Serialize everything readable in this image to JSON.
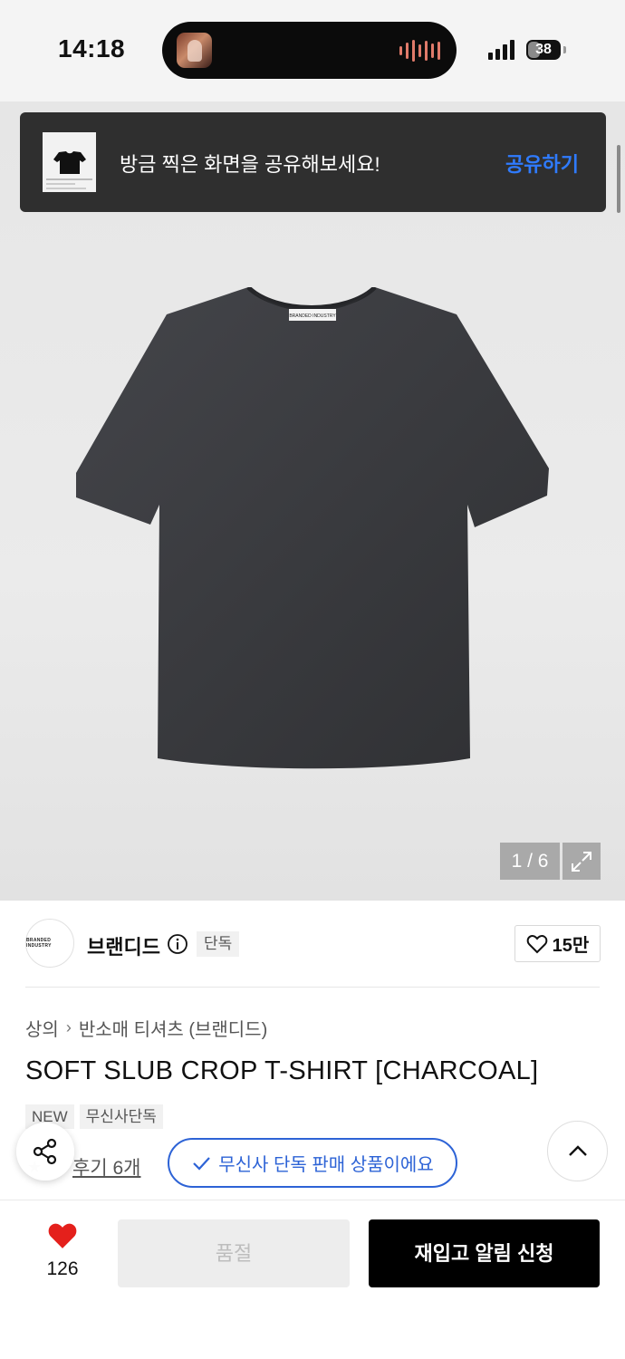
{
  "status_bar": {
    "time": "14:18",
    "battery": "38",
    "battery_level": 0.38
  },
  "toast": {
    "message": "방금 찍은 화면을 공유해보세요!",
    "action": "공유하기"
  },
  "gallery": {
    "counter": "1 / 6",
    "current": 1,
    "total": 6,
    "shirt_label": "BRANDED INDUSTRY"
  },
  "brand": {
    "logo_text": "BRANDED INDUSTRY",
    "name": "브랜디드",
    "exclusive_tag": "단독",
    "likes": "15만"
  },
  "product": {
    "breadcrumb": [
      "상의",
      "반소매 티셔츠 (브랜디드)"
    ],
    "title": "SOFT SLUB CROP T-SHIRT [CHARCOAL]",
    "badges": [
      "NEW",
      "무신사단독"
    ],
    "review_link": "후기 6개",
    "exclusive_notice": "무신사 단독 판매 상품이에요"
  },
  "bottom_bar": {
    "wish_count": "126",
    "soldout_label": "품절",
    "restock_label": "재입고 알림 신청"
  },
  "colors": {
    "accent_blue": "#2d63d6",
    "toast_action": "#2f7bff",
    "heart_red": "#e4201c",
    "toast_bg": "#2f2f2f",
    "shirt_charcoal": "#3a3b3e"
  },
  "icons": {
    "info": "info-icon",
    "heart_outline": "heart-outline-icon",
    "heart_filled": "heart-filled-icon",
    "share": "share-icon",
    "chevron_up": "chevron-up-icon",
    "check": "check-icon",
    "expand": "expand-icon",
    "chevron_right": "chevron-right-icon"
  }
}
